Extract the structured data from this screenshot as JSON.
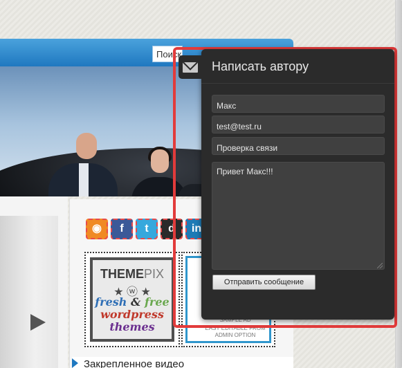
{
  "site": {
    "search_placeholder": "Поиск",
    "social_icons": [
      "rss-icon",
      "facebook-icon",
      "twitter-icon",
      "digg-icon",
      "linkedin-icon"
    ],
    "ad_left": {
      "brand_main": "THEME",
      "brand_suffix": "PIX",
      "stars": "★ ⓦ ★",
      "line1_a": "fresh",
      "line1_b": " & ",
      "line1_c": "free",
      "line2": "wordpress",
      "line3": "themes"
    },
    "ad_right": {
      "line1": "SAMPLE AD",
      "line2": "EASY EDITABLE FROM",
      "line3": "ADMIN OPTION"
    },
    "featured_label": "Закрепленное видео"
  },
  "contact_popup": {
    "title": "Написать автору",
    "name_value": "Макс",
    "email_value": "test@test.ru",
    "subject_value": "Проверка связи",
    "message_value": "Привет Макс!!!",
    "send_label": "Отправить сообщение"
  },
  "colors": {
    "highlight": "#e23b3b",
    "popup_bg": "#2b2b2b",
    "nav_blue": "#1f78c0"
  }
}
